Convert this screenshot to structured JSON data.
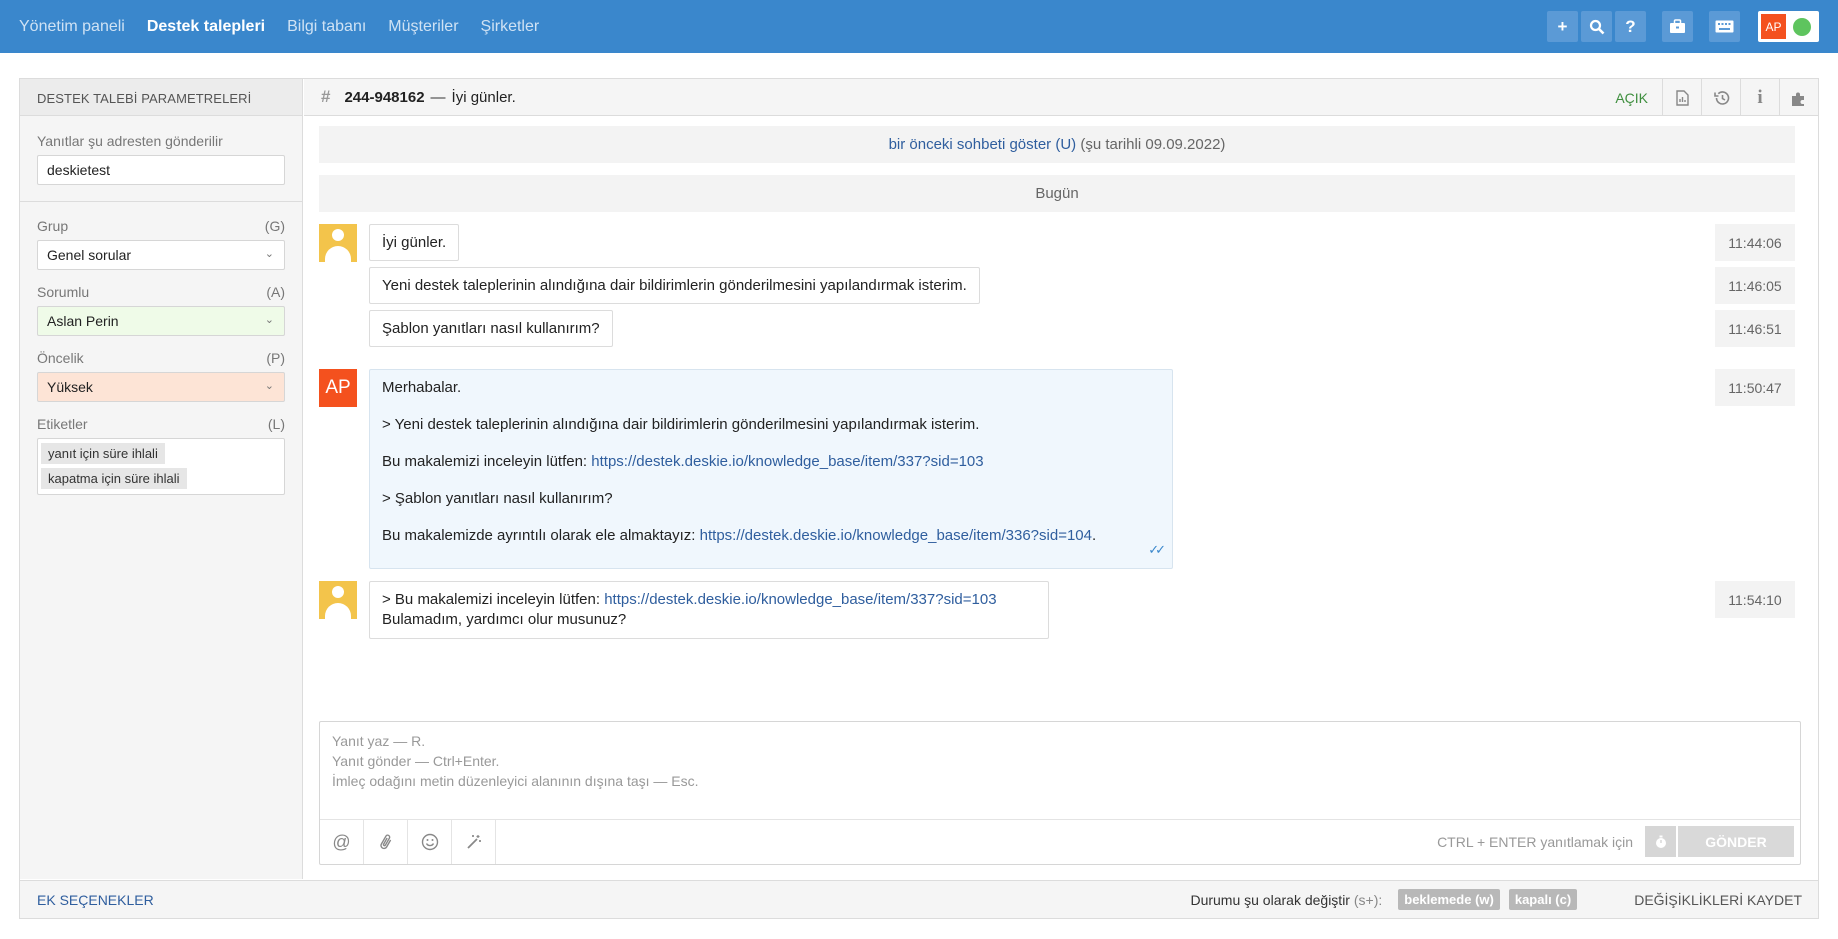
{
  "nav": {
    "items": [
      {
        "label": "Yönetim paneli"
      },
      {
        "label": "Destek talepleri"
      },
      {
        "label": "Bilgi tabanı"
      },
      {
        "label": "Müşteriler"
      },
      {
        "label": "Şirketler"
      }
    ],
    "active_index": 1,
    "user_initials": "AP"
  },
  "sidebar": {
    "title": "DESTEK TALEBİ PARAMETRELERİ",
    "reply_to_label": "Yanıtlar şu adresten gönderilir",
    "reply_to_value": "deskietest",
    "group_label": "Grup",
    "group_key": "(G)",
    "group_value": "Genel sorular",
    "assignee_label": "Sorumlu",
    "assignee_key": "(A)",
    "assignee_value": "Aslan Perin",
    "priority_label": "Öncelik",
    "priority_key": "(P)",
    "priority_value": "Yüksek",
    "tags_label": "Etiketler",
    "tags_key": "(L)",
    "tags": [
      "yanıt için süre ihlali",
      "kapatma için süre ihlali"
    ]
  },
  "ticket": {
    "id": "244-948162",
    "sep": "—",
    "title": "İyi günler.",
    "state": "AÇIK"
  },
  "chat": {
    "prev_link": "bir önceki sohbeti göster (U)",
    "prev_date": "(şu tarihli 09.09.2022)",
    "day_label": "Bugün",
    "msg1": {
      "text": "İyi günler.",
      "time": "11:44:06"
    },
    "msg2": {
      "text": "Yeni destek taleplerinin alındığına dair bildirimlerin gönderilmesini yapılandırmak isterim.",
      "time": "11:46:05"
    },
    "msg3": {
      "text": "Şablon yanıtları nasıl kullanırım?",
      "time": "11:46:51"
    },
    "agent_initials": "AP",
    "msg4": {
      "time": "11:50:47",
      "line1": "Merhabalar.",
      "line2": "> Yeni destek taleplerinin alındığına dair bildirimlerin gönderilmesini yapılandırmak isterim.",
      "line3_text": "Bu makalemizi inceleyin lütfen: ",
      "line3_link": "https://destek.deskie.io/knowledge_base/item/337?sid=103",
      "line4": "> Şablon yanıtları nasıl kullanırım?",
      "line5_text": "Bu makalemizde ayrıntılı olarak ele almaktayız: ",
      "line5_link": "https://destek.deskie.io/knowledge_base/item/336?sid=104",
      "line5_end": "."
    },
    "msg5": {
      "time": "11:54:10",
      "quote_text": "> Bu makalemizi inceleyin lütfen: ",
      "quote_link": "https://destek.deskie.io/knowledge_base/item/337?sid=103",
      "line2": "Bulamadım, yardımcı olur musunuz?"
    }
  },
  "composer": {
    "line1": "Yanıt yaz — R.",
    "line2": "Yanıt gönder — Ctrl+Enter.",
    "line3": "İmleç odağını metin düzenleyici alanının dışına taşı — Esc.",
    "hint": "CTRL + ENTER yanıtlamak için",
    "send_label": "GÖNDER"
  },
  "footer": {
    "extra_options": "EK SEÇENEKLER",
    "status_label": "Durumu şu olarak değiştir",
    "status_key": "(s+):",
    "pending": "beklemede (w)",
    "closed": "kapalı (c)",
    "save": "DEĞİŞİKLİKLERİ KAYDET"
  }
}
